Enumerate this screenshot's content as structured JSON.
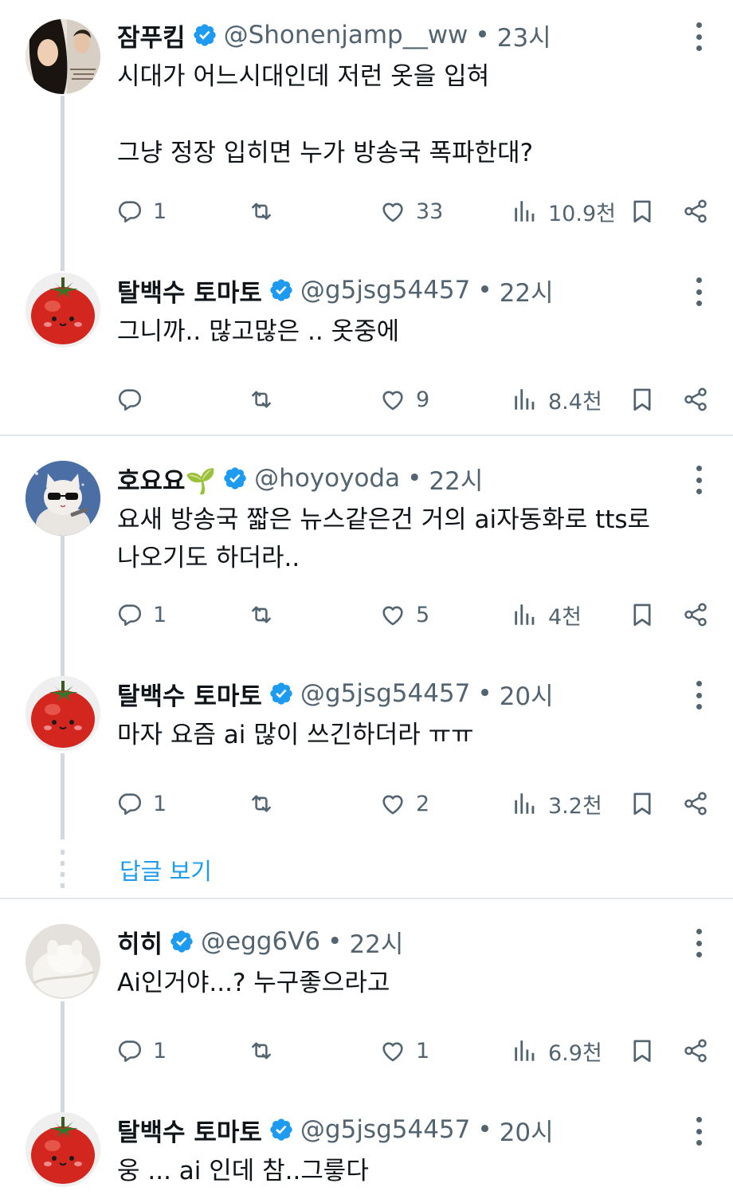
{
  "tweets": [
    {
      "name": "잠푸킴",
      "handle": "@Shonenjamp__ww",
      "time": "23시",
      "text": "시대가 어느시대인데 저런 옷을 입혀\n\n그냥 정장 입히면 누가 방송국 폭파한대?",
      "replies": "1",
      "retweets": "",
      "likes": "33",
      "views": "10.9천",
      "avatar": "drama-poster-avatar"
    },
    {
      "name": "탈백수 토마토",
      "handle": "@g5jsg54457",
      "time": "22시",
      "text": "그니까.. 많고많은 .. 옷중에",
      "replies": "",
      "retweets": "",
      "likes": "9",
      "views": "8.4천",
      "avatar": "tomato-avatar"
    },
    {
      "name": "호요요🌱",
      "handle": "@hoyoyoda",
      "time": "22시",
      "text": "요새 방송국 짧은 뉴스같은건 거의 ai자동화로 tts로\n나오기도 하더라..",
      "replies": "1",
      "retweets": "",
      "likes": "5",
      "views": "4천",
      "avatar": "cat-sunglasses-avatar"
    },
    {
      "name": "탈백수 토마토",
      "handle": "@g5jsg54457",
      "time": "20시",
      "text": "마자 요즘 ai 많이 쓰긴하더라 ㅠㅠ",
      "replies": "1",
      "retweets": "",
      "likes": "2",
      "views": "3.2천",
      "avatar": "tomato-avatar"
    },
    {
      "name": "히히",
      "handle": "@egg6V6",
      "time": "22시",
      "text": "Ai인거야...? 누구좋으라고",
      "replies": "1",
      "retweets": "",
      "likes": "1",
      "views": "6.9천",
      "avatar": "white-plush-avatar"
    },
    {
      "name": "탈백수 토마토",
      "handle": "@g5jsg54457",
      "time": "20시",
      "text": "웅 ... ai 인데 참..그릏다",
      "avatar": "tomato-avatar"
    }
  ],
  "show_replies_label": "답글 보기",
  "colors": {
    "text": "#0f1419",
    "secondary": "#536471",
    "accent": "#1d9bf0",
    "thread": "#cfd9de"
  },
  "icons": [
    "reply-icon",
    "retweet-icon",
    "like-icon",
    "views-icon",
    "bookmark-icon",
    "share-icon",
    "verified-badge-icon",
    "more-icon"
  ]
}
